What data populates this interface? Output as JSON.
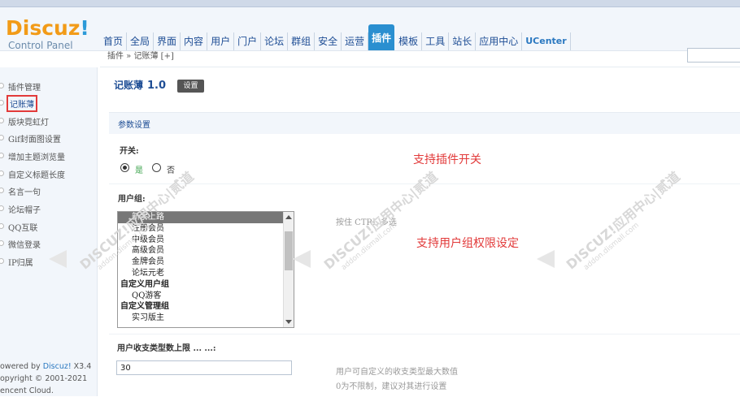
{
  "header": {
    "brand": "Discuz",
    "brand_bang": "!",
    "subtitle": "Control Panel",
    "nav": [
      "首页",
      "全局",
      "界面",
      "内容",
      "用户",
      "门户",
      "论坛",
      "群组",
      "安全",
      "运营",
      "插件",
      "模板",
      "工具",
      "站长",
      "应用中心",
      "UCenter"
    ],
    "active_nav": "插件"
  },
  "breadcrumb": {
    "path": "插件 » 记账薄",
    "add": "[+]"
  },
  "sidebar": {
    "items": [
      "插件管理",
      "记账薄",
      "版块霓虹灯",
      "Gif封面图设置",
      "增加主题浏览量",
      "自定义标题长度",
      "名言一句",
      "论坛帽子",
      "QQ互联",
      "微信登录",
      "IP归属"
    ],
    "active": "记账薄"
  },
  "footer": {
    "line1_prefix": "owered by ",
    "line1_link": "Discuz!",
    "line1_suffix": " X3.4",
    "line2": "opyright © 2001-2021",
    "line3": "encent Cloud."
  },
  "main": {
    "plugin_name": "记账薄",
    "plugin_version": "1.0",
    "settings_button": "设置",
    "section_title": "参数设置",
    "switch_label": "开关:",
    "radio_yes": "是",
    "radio_no": "否",
    "annot_switch": "支持插件开关",
    "usergroup_label": "用户组:",
    "usergroup_tip": "按住 CTRL 多选",
    "annot_usergroup": "支持用户组权限设定",
    "usergroups": [
      {
        "label": "新手上路",
        "group": false,
        "selected": true
      },
      {
        "label": "注册会员",
        "group": false,
        "selected": false
      },
      {
        "label": "中级会员",
        "group": false,
        "selected": false
      },
      {
        "label": "高级会员",
        "group": false,
        "selected": false
      },
      {
        "label": "金牌会员",
        "group": false,
        "selected": false
      },
      {
        "label": "论坛元老",
        "group": false,
        "selected": false
      },
      {
        "label": "自定义用户组",
        "group": true,
        "selected": false
      },
      {
        "label": "QQ游客",
        "group": false,
        "selected": false
      },
      {
        "label": "自定义管理组",
        "group": true,
        "selected": false
      },
      {
        "label": "实习版主",
        "group": false,
        "selected": false
      }
    ],
    "limit_label": "用户收支类型数上限 ... ...:",
    "limit_value": "30",
    "limit_tip1": "用户可自定义的收支类型最大数值",
    "limit_tip2": "0为不限制，建议对其进行设置"
  },
  "watermark": {
    "text": "DISCUZ!应用中心|贰道",
    "sub": "addon.dismall.com"
  }
}
